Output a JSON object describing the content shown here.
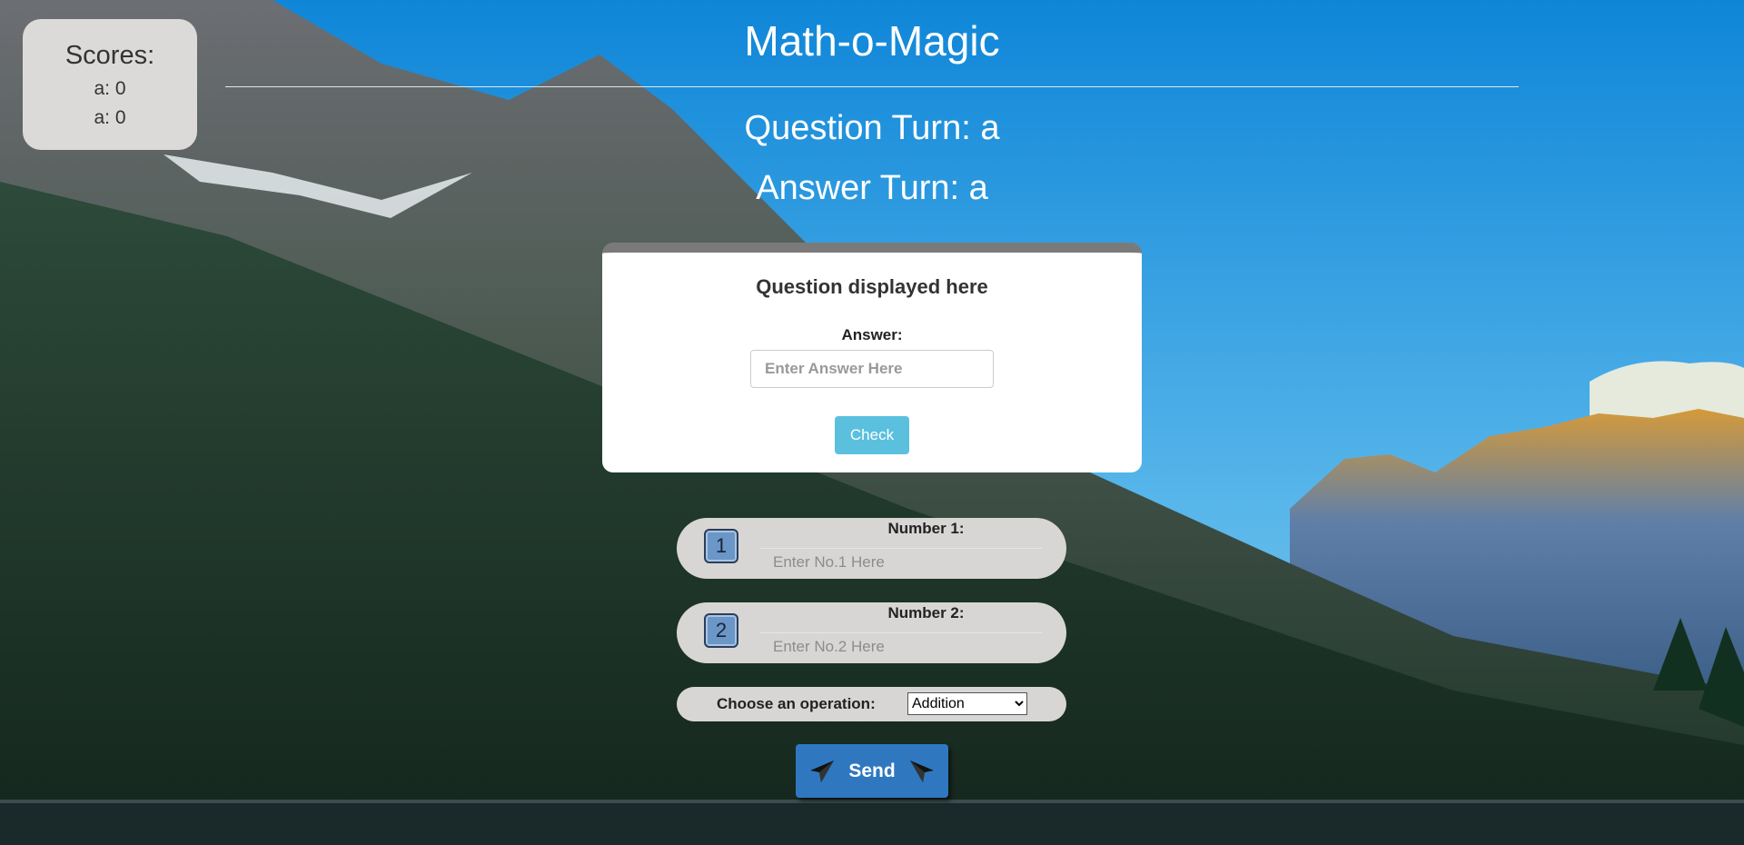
{
  "colors": {
    "scores_bg": "#dcdad9",
    "card_top_border": "#7a7a7a",
    "check_button": "#5bc0de",
    "send_button": "#2f78c0",
    "pill_bg": "#d8d6d5"
  },
  "background": {
    "icon": "mountain-lake-scenery"
  },
  "scores": {
    "title": "Scores:",
    "rows": [
      "a: 0",
      "a: 0"
    ]
  },
  "header": {
    "title": "Math-o-Magic",
    "question_turn": "Question Turn: a",
    "answer_turn": "Answer Turn: a"
  },
  "question_card": {
    "question": "Question displayed here",
    "answer_label": "Answer:",
    "answer_placeholder": "Enter Answer Here",
    "check_label": "Check"
  },
  "number1": {
    "badge": "1",
    "label": "Number 1:",
    "placeholder": "Enter No.1 Here"
  },
  "number2": {
    "badge": "2",
    "label": "Number 2:",
    "placeholder": "Enter No.2 Here"
  },
  "operation": {
    "label": "Choose an operation:",
    "selected": "Addition"
  },
  "send": {
    "label": "Send",
    "icon": "paper-plane-icon"
  }
}
